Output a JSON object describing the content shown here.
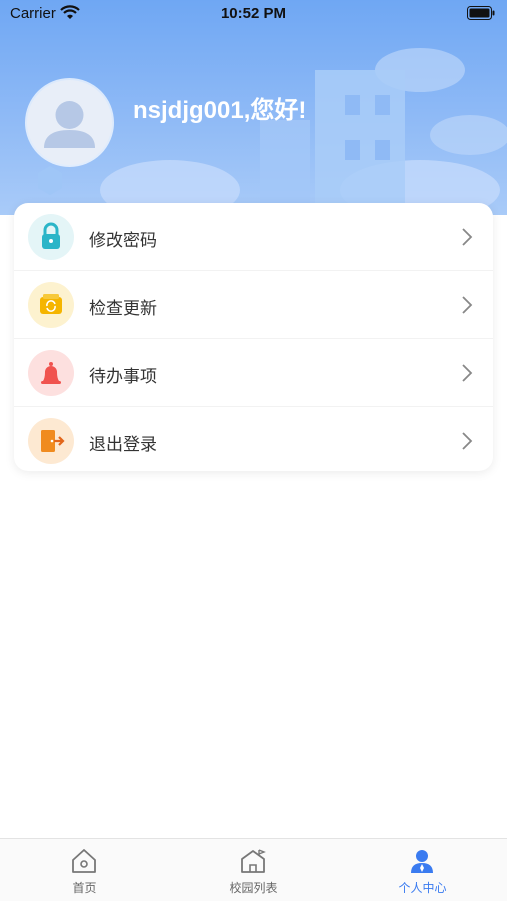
{
  "status_bar": {
    "carrier": "Carrier",
    "time": "10:52 PM"
  },
  "profile": {
    "greeting": "nsjdjg001,您好!"
  },
  "menu": {
    "items": [
      {
        "label": "修改密码",
        "icon": "lock-icon",
        "color": "#2bb5c8"
      },
      {
        "label": "检查更新",
        "icon": "refresh-icon",
        "color": "#f5b500"
      },
      {
        "label": "待办事项",
        "icon": "bell-icon",
        "color": "#f0534f"
      },
      {
        "label": "退出登录",
        "icon": "exit-door-icon",
        "color": "#f08b1f"
      }
    ]
  },
  "tab_bar": {
    "tabs": [
      {
        "label": "首页",
        "icon": "home-icon",
        "active": false
      },
      {
        "label": "校园列表",
        "icon": "school-icon",
        "active": false
      },
      {
        "label": "个人中心",
        "icon": "user-icon",
        "active": true
      }
    ]
  },
  "colors": {
    "header_gradient_top": "#6fa7f3",
    "header_gradient_bottom": "#a9cbf8",
    "active_tab": "#3a7bf0"
  }
}
